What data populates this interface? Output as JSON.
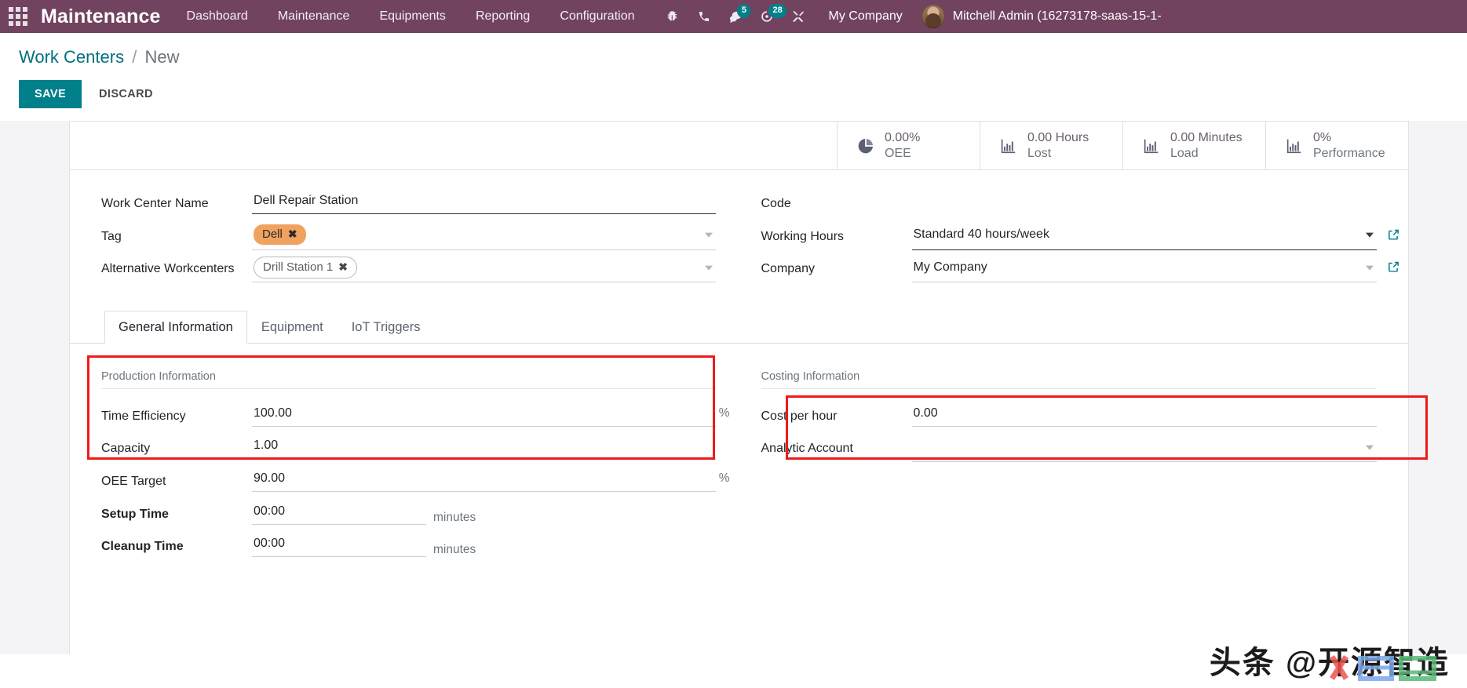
{
  "navbar": {
    "apps_icon": "apps-grid-icon",
    "brand": "Maintenance",
    "menu": [
      {
        "label": "Dashboard"
      },
      {
        "label": "Maintenance"
      },
      {
        "label": "Equipments"
      },
      {
        "label": "Reporting"
      },
      {
        "label": "Configuration"
      }
    ],
    "icons": [
      {
        "name": "bug-icon",
        "badge": ""
      },
      {
        "name": "phone-icon",
        "badge": ""
      },
      {
        "name": "messages-icon",
        "badge": "5"
      },
      {
        "name": "activity-clock-icon",
        "badge": "28"
      },
      {
        "name": "tools-icon",
        "badge": ""
      }
    ],
    "company": "My Company",
    "user": "Mitchell Admin (16273178-saas-15-1-",
    "badge_color": "#00808a",
    "background": "#71435f"
  },
  "breadcrumb": {
    "root": "Work Centers",
    "separator": "/",
    "current": "New"
  },
  "actions": {
    "save": "SAVE",
    "discard": "DISCARD",
    "save_color": "#00808a"
  },
  "stats": [
    {
      "icon": "pie-chart-icon",
      "value": "0.00%",
      "label": "OEE"
    },
    {
      "icon": "bar-chart-icon",
      "value": "0.00 Hours",
      "label": "Lost"
    },
    {
      "icon": "bar-chart-icon",
      "value": "0.00 Minutes",
      "label": "Load"
    },
    {
      "icon": "bar-chart-icon",
      "value": "0%",
      "label": "Performance"
    }
  ],
  "form": {
    "left": {
      "work_center_name_label": "Work Center Name",
      "work_center_name_value": "Dell Repair Station",
      "tag_label": "Tag",
      "tag_value": "Dell",
      "tag_remove": "✖",
      "alt_workcenters_label": "Alternative Workcenters",
      "alt_workcenters_value": "Drill Station 1",
      "alt_remove": "✖"
    },
    "right": {
      "code_label": "Code",
      "code_value": "",
      "working_hours_label": "Working Hours",
      "working_hours_value": "Standard 40 hours/week",
      "company_label": "Company",
      "company_value": "My Company"
    }
  },
  "highlight_color": "#f01a1a",
  "notebook": {
    "tabs": [
      {
        "label": "General Information",
        "active": true
      },
      {
        "label": "Equipment",
        "active": false
      },
      {
        "label": "IoT Triggers",
        "active": false
      }
    ],
    "production": {
      "title": "Production Information",
      "fields": [
        {
          "label": "Time Efficiency",
          "value": "100.00",
          "suffix": "%",
          "bold": false
        },
        {
          "label": "Capacity",
          "value": "1.00",
          "suffix": "",
          "bold": false
        },
        {
          "label": "OEE Target",
          "value": "90.00",
          "suffix": "%",
          "bold": false
        },
        {
          "label": "Setup Time",
          "value": "00:00",
          "suffix": "minutes",
          "bold": true
        },
        {
          "label": "Cleanup Time",
          "value": "00:00",
          "suffix": "minutes",
          "bold": true
        }
      ]
    },
    "costing": {
      "title": "Costing Information",
      "fields": [
        {
          "label": "Cost per hour",
          "value": "0.00"
        },
        {
          "label": "Analytic Account",
          "value": ""
        }
      ]
    }
  },
  "watermark": {
    "text": "头条 @开源智造"
  }
}
